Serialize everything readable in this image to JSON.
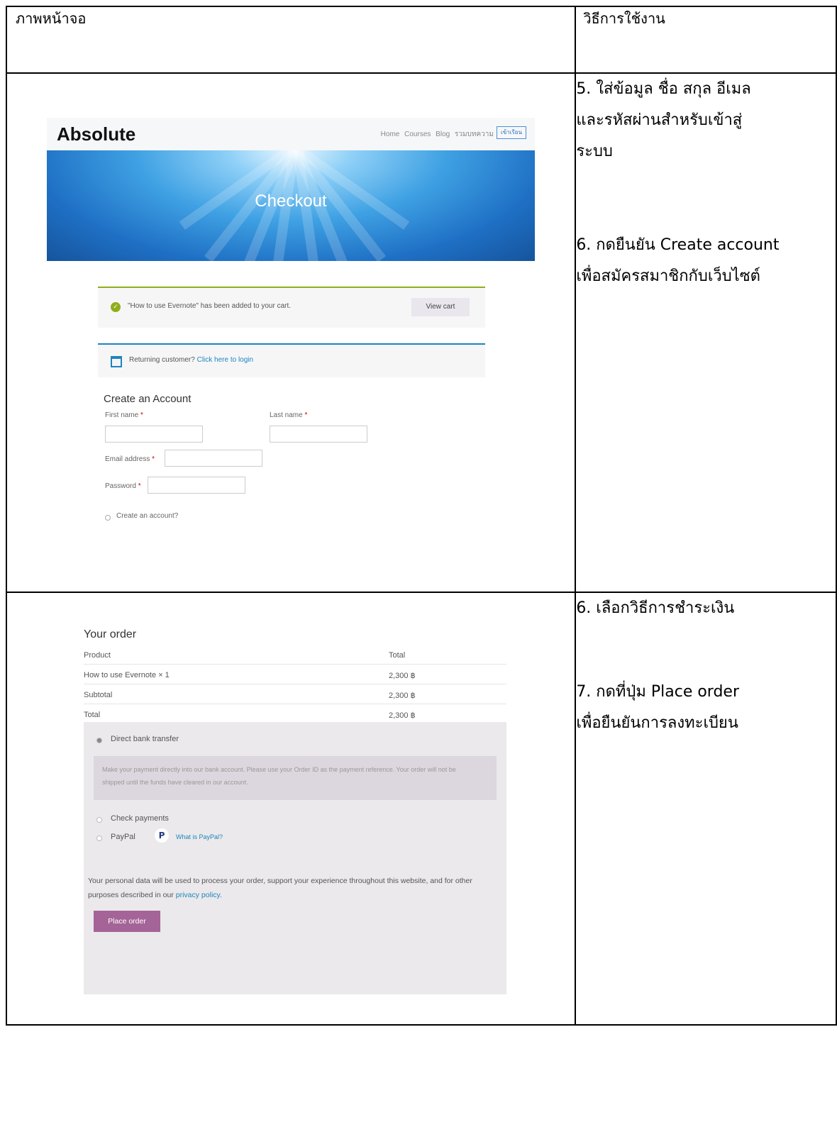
{
  "table": {
    "header": {
      "col1": "ภาพหน้าจอ",
      "col2": "วิธีการใช้งาน"
    },
    "row1_steps": [
      "5. ใส่ข้อมูล ชื่อ สกุล อีเมล",
      "และรหัสผ่านสำหรับเข้าสู่",
      "ระบบ",
      "6. กดยืนยัน Create account",
      "เพื่อสมัครสมาชิกกับเว็บไซต์"
    ],
    "row2_steps": [
      "6. เลือกวิธีการชำระเงิน",
      "7. กดที่ปุ่ม Place order",
      "เพื่อยืนยันการลงทะเบียน"
    ]
  },
  "checkout_screenshot": {
    "logo": "Absolute",
    "nav": [
      "Home",
      "Courses",
      "Blog",
      "รวมบทความ"
    ],
    "nav_button": "เข้าเรียน",
    "banner_title": "Checkout",
    "cart_notice": "\"How to use Evernote\" has been added to your cart.",
    "view_cart": "View cart",
    "returning_text": "Returning customer?",
    "returning_link": "Click here to login",
    "create_title": "Create an Account",
    "first_name_label": "First name",
    "last_name_label": "Last name",
    "email_label": "Email address",
    "password_label": "Password",
    "required_mark": "*",
    "create_checkbox": "Create an account?",
    "colors": {
      "success": "#8fae1b",
      "info": "#1e85be",
      "banner": "#1e6fc4"
    }
  },
  "order_screenshot": {
    "title": "Your order",
    "head_product": "Product",
    "head_total": "Total",
    "item_name": "How to use Evernote",
    "item_qty": "× 1",
    "item_total": "2,300 ฿",
    "subtotal_label": "Subtotal",
    "subtotal_value": "2,300 ฿",
    "total_label": "Total",
    "total_value": "2,300 ฿",
    "methods": [
      "Direct bank transfer",
      "Check payments",
      "PayPal"
    ],
    "bank_desc": "Make your payment directly into our bank account. Please use your Order ID as the payment reference. Your order will not be shipped until the funds have cleared in our account.",
    "paypal_link": "What is PayPal?",
    "privacy_text": "Your personal data will be used to process your order, support your experience throughout this website, and for other purposes described in our",
    "privacy_link": "privacy policy.",
    "place_order": "Place order",
    "colors": {
      "place_order_bg": "#a46497"
    }
  }
}
